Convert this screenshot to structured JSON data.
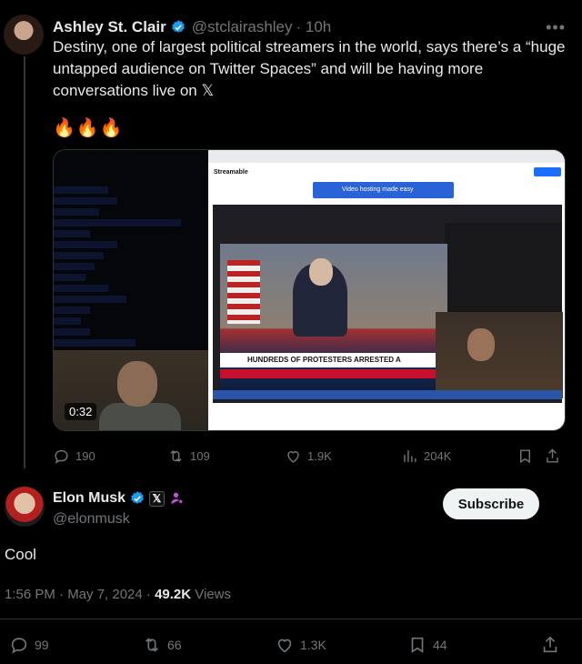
{
  "quoted_post": {
    "author_name": "Ashley St. Clair",
    "handle": "@stclairashley",
    "time": "· 10h",
    "text": "Destiny, one of largest political streamers in the world, says there’s a “huge untapped audience on Twitter Spaces” and will be having more conversations live on 𝕏",
    "emoji": "🔥🔥🔥",
    "video_duration": "0:32",
    "video_frame": {
      "site_logo": "Streamable",
      "banner_text": "Video hosting made easy",
      "news_ticker": "HUNDREDS OF PROTESTERS ARRESTED A"
    },
    "stats": {
      "replies": "190",
      "reposts": "109",
      "likes": "1.9K",
      "views": "204K"
    }
  },
  "post": {
    "author_name": "Elon Musk",
    "handle": "@elonmusk",
    "subscribe_label": "Subscribe",
    "text": "Cool",
    "timestamp": "1:56 PM · May 7, 2024 · ",
    "views_count": "49.2K",
    "views_label": " Views",
    "stats": {
      "replies": "99",
      "reposts": "66",
      "likes": "1.3K",
      "bookmarks": "44"
    }
  },
  "colors": {
    "background": "#000000",
    "text": "#e7e9ea",
    "muted": "#71767b",
    "verified": "#1d9bf0",
    "divider": "#2f3336"
  }
}
